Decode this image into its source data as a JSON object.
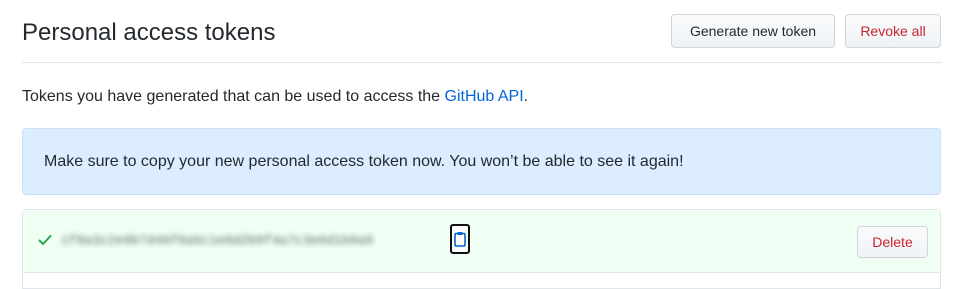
{
  "header": {
    "title": "Personal access tokens",
    "generate_label": "Generate new token",
    "revoke_label": "Revoke all"
  },
  "intro": {
    "text": "Tokens you have generated that can be used to access the ",
    "link_text": "GitHub API",
    "suffix": "."
  },
  "flash": {
    "message": "Make sure to copy your new personal access token now. You won’t be able to see it again!"
  },
  "token": {
    "value": "1f8a3c2e9b7d46f0a5c1e8d2b9f4a7c3e6d1b0a9",
    "delete_label": "Delete",
    "status_icon": "check-icon",
    "copy_icon": "clipboard-icon"
  },
  "colors": {
    "danger": "#cb2431",
    "link": "#0366d6",
    "flash_bg": "#dbedff",
    "success_bg": "#f0fff4",
    "success_icon": "#28a745"
  }
}
